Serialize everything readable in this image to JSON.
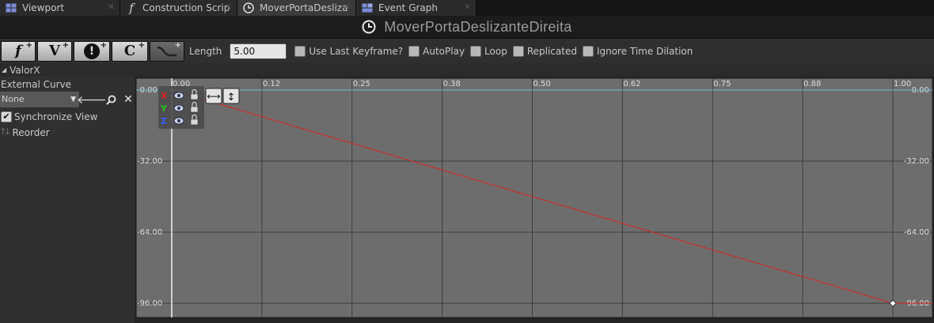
{
  "tabs": [
    {
      "label": "Viewport",
      "icon": "viewport-icon",
      "active": false
    },
    {
      "label": "Construction Scrip",
      "icon": "function-icon",
      "active": false
    },
    {
      "label": "MoverPortaDesliza",
      "icon": "timeline-icon",
      "active": true
    },
    {
      "label": "Event Graph",
      "icon": "event-graph-icon",
      "active": false
    }
  ],
  "title": "MoverPortaDeslizanteDireita",
  "toolbar": {
    "buttons": [
      {
        "glyph": "f",
        "icon": "add-float-track-icon"
      },
      {
        "glyph": "V",
        "icon": "add-vector-track-icon"
      },
      {
        "glyph": "!",
        "icon": "add-event-track-icon"
      },
      {
        "glyph": "C",
        "icon": "add-color-track-icon"
      },
      {
        "glyph": "",
        "icon": "add-curve-asset-icon"
      }
    ],
    "length_label": "Length",
    "length_value": "5.00",
    "options": [
      {
        "label": "Use Last Keyframe?",
        "checked": false
      },
      {
        "label": "AutoPlay",
        "checked": false
      },
      {
        "label": "Loop",
        "checked": false
      },
      {
        "label": "Replicated",
        "checked": false
      },
      {
        "label": "Ignore Time Dilation",
        "checked": false
      }
    ]
  },
  "track": {
    "name": "ValorX",
    "external_curve_label": "External Curve",
    "external_curve_value": "None",
    "synchronize_label": "Synchronize View",
    "synchronize_checked": true,
    "reorder_label": "Reorder",
    "channels": [
      {
        "label": "X",
        "color": "#e02020"
      },
      {
        "label": "Y",
        "color": "#20c020"
      },
      {
        "label": "Z",
        "color": "#3a5cff"
      }
    ]
  },
  "chart_data": {
    "type": "line",
    "x_ticks": [
      "0.00",
      "0.12",
      "0.25",
      "0.38",
      "0.50",
      "0.62",
      "0.75",
      "0.88",
      "1.00"
    ],
    "y_ticks": [
      "-0.00",
      "-32.00",
      "-64.00",
      "-96.00"
    ],
    "xlim": [
      0.0,
      1.0
    ],
    "ylim": [
      -96.0,
      0.0
    ],
    "series": [
      {
        "x": [
          0.0,
          1.0
        ],
        "y": [
          0.0,
          -96.0
        ],
        "color": "#c83030"
      }
    ],
    "keys": [
      {
        "x": 0.0,
        "y": 0.0
      },
      {
        "x": 1.0,
        "y": -96.0
      }
    ]
  }
}
